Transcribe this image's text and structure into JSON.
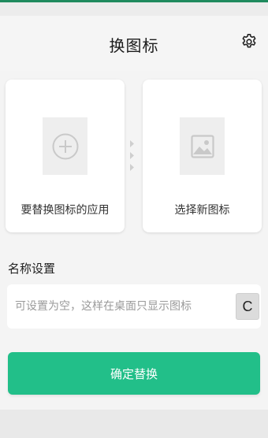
{
  "header": {
    "title": "换图标",
    "settings_icon": "gear-icon"
  },
  "cards": {
    "source_app": {
      "label": "要替换图标的应用",
      "icon": "add-circle-icon"
    },
    "new_icon": {
      "label": "选择新图标",
      "icon": "image-icon"
    },
    "separator_icon": "chevron-arrows-icon"
  },
  "name_settings": {
    "title": "名称设置",
    "input_value": "",
    "input_placeholder": "可设置为空，这样在桌面只显示图标",
    "reset_label": "C"
  },
  "confirm": {
    "label": "确定替换"
  },
  "colors": {
    "accent": "#22bf89",
    "status_bar_line": "#1f8a5e"
  }
}
